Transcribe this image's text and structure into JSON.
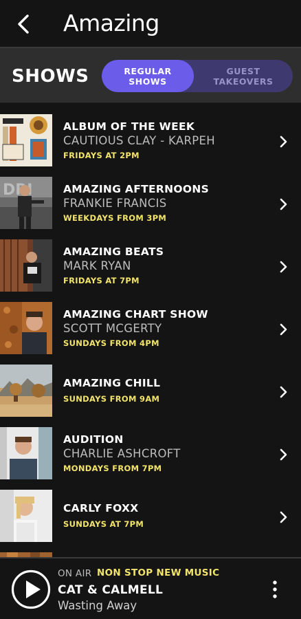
{
  "header": {
    "brand": "Amazing",
    "back_icon": "back-arrow-icon"
  },
  "section": {
    "title": "SHOWS",
    "tabs": [
      {
        "label": "REGULAR\nSHOWS",
        "selected": true
      },
      {
        "label": "GUEST\nTAKEOVERS",
        "selected": false
      }
    ]
  },
  "colors": {
    "accent": "#6b5cea",
    "time": "#f2e46b",
    "background": "#141414",
    "section_bg": "#2e2e2e"
  },
  "shows": [
    {
      "name": "ALBUM OF THE WEEK",
      "host": "CAUTIOUS CLAY - KARPEH",
      "time": "FRIDAYS AT 2PM"
    },
    {
      "name": "AMAZING AFTERNOONS",
      "host": "FRANKIE FRANCIS",
      "time": "WEEKDAYS FROM 3PM"
    },
    {
      "name": "AMAZING BEATS",
      "host": "MARK RYAN",
      "time": "FRIDAYS AT 7PM"
    },
    {
      "name": "AMAZING CHART SHOW",
      "host": "SCOTT MCGERTY",
      "time": "SUNDAYS FROM 4PM"
    },
    {
      "name": "AMAZING CHILL",
      "host": "",
      "time": "SUNDAYS FROM 9AM"
    },
    {
      "name": "AUDITION",
      "host": "CHARLIE ASHCROFT",
      "time": "MONDAYS FROM 7PM"
    },
    {
      "name": "CARLY FOXX",
      "host": "",
      "time": "SUNDAYS AT 7PM"
    }
  ],
  "player": {
    "on_air_label": "ON AIR",
    "show": "NON STOP NEW MUSIC",
    "artist": "CAT & CALMELL",
    "song": "Wasting Away"
  }
}
